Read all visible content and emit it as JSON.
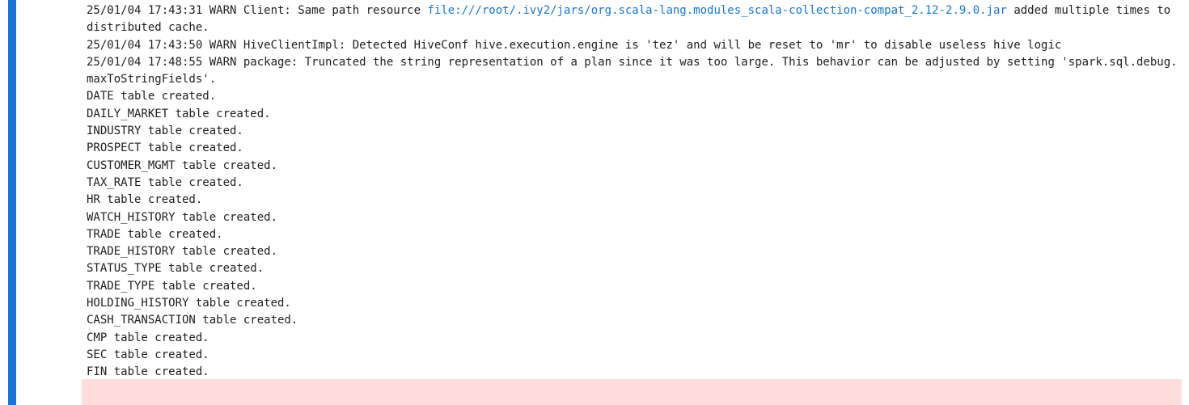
{
  "colors": {
    "cell_bar": "#1976d2",
    "link": "#1976d2",
    "stderr_background": "#ffdddd",
    "text": "#212121"
  },
  "output": {
    "warn_lines": [
      {
        "before": "25/01/04 17:43:31 WARN Client: Same path resource ",
        "link": "file:///root/.ivy2/jars/org.scala-lang.modules_scala-collection-compat_2.12-2.9.0.jar",
        "after": " added multiple times to distributed cache."
      },
      {
        "before": "25/01/04 17:43:50 WARN HiveClientImpl: Detected HiveConf hive.execution.engine is 'tez' and will be reset to 'mr' to disable useless hive logic",
        "link": "",
        "after": ""
      },
      {
        "before": "25/01/04 17:48:55 WARN package: Truncated the string representation of a plan since it was too large. This behavior can be adjusted by setting 'spark.sql.debug.maxToStringFields'.",
        "link": "",
        "after": ""
      }
    ],
    "table_lines": [
      "DATE table created.",
      "DAILY_MARKET table created.",
      "INDUSTRY table created.",
      "PROSPECT table created.",
      "CUSTOMER_MGMT table created.",
      "TAX_RATE table created.",
      "HR table created.",
      "WATCH_HISTORY table created.",
      "TRADE table created.",
      "TRADE_HISTORY table created.",
      "STATUS_TYPE table created.",
      "TRADE_TYPE table created.",
      "HOLDING_HISTORY table created.",
      "CASH_TRANSACTION table created.",
      "CMP table created.",
      "SEC table created.",
      "FIN table created."
    ]
  }
}
